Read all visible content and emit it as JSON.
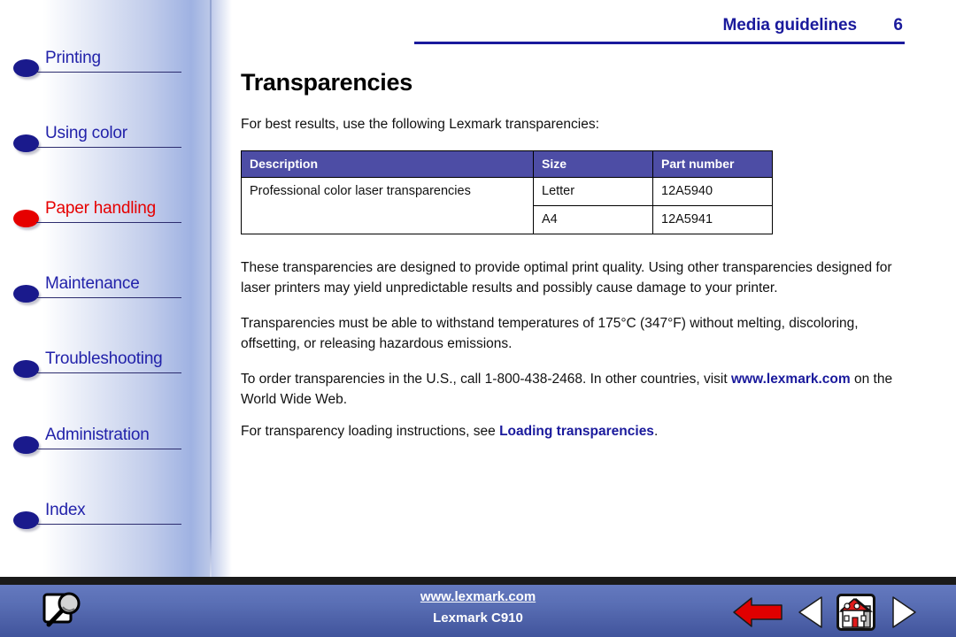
{
  "header": {
    "title": "Media guidelines",
    "page_number": "6"
  },
  "sidebar": {
    "items": [
      {
        "label": "Printing",
        "state": "normal",
        "bullet_color": "#1a1a8c"
      },
      {
        "label": "Using color",
        "state": "normal",
        "bullet_color": "#1a1a8c"
      },
      {
        "label": "Paper handling",
        "state": "current",
        "bullet_color": "#e60000"
      },
      {
        "label": "Maintenance",
        "state": "normal",
        "bullet_color": "#1a1a8c"
      },
      {
        "label": "Troubleshooting",
        "state": "normal",
        "bullet_color": "#1a1a8c"
      },
      {
        "label": "Administration",
        "state": "normal",
        "bullet_color": "#1a1a8c"
      },
      {
        "label": "Index",
        "state": "normal",
        "bullet_color": "#1a1a8c"
      }
    ]
  },
  "main": {
    "heading": "Transparencies",
    "intro": "For best results, use the following Lexmark transparencies:",
    "table": {
      "columns": [
        "Description",
        "Size",
        "Part number"
      ],
      "rows": [
        {
          "description": "Professional color laser transparencies",
          "size": "Letter",
          "part_number": "12A5940"
        },
        {
          "description": "",
          "size": "A4",
          "part_number": "12A5941"
        }
      ]
    },
    "paragraph_1": "These transparencies are designed to provide optimal print quality. Using other transparencies designed for laser printers may yield unpredictable results and possibly cause damage to your printer.",
    "paragraph_2": "Transparencies must be able to withstand temperatures of 175°C (347°F) without melting, discoloring, offsetting, or releasing hazardous emissions.",
    "paragraph_3_pre": "To order transparencies in the U.S., call 1-800-438-2468. In other countries, visit ",
    "paragraph_3_link": "www.lexmark.com",
    "paragraph_3_post": " on the World Wide Web.",
    "paragraph_4_pre": "For transparency loading instructions, see ",
    "paragraph_4_link": "Loading transparencies",
    "paragraph_4_post": "."
  },
  "footer": {
    "url": "www.lexmark.com",
    "model": "Lexmark C910",
    "search_icon": "page-magnifier-icon",
    "back_icon": "red-back-arrow-icon",
    "prev_icon": "previous-page-triangle-icon",
    "home_icon": "house-icon",
    "next_icon": "next-page-triangle-icon"
  },
  "colors": {
    "accent_blue": "#1a1a9c",
    "current_red": "#e60000",
    "table_header": "#4d4da5",
    "footer_blue": "#5a6fb5"
  }
}
